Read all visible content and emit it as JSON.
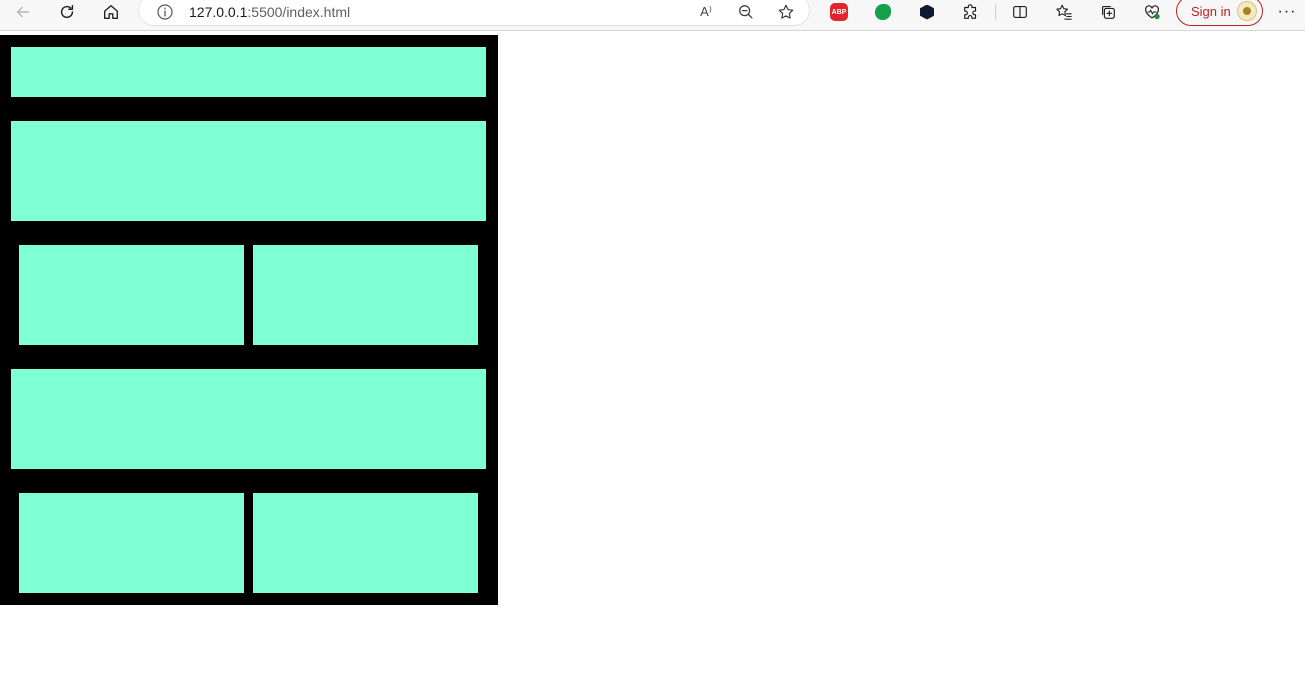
{
  "browser": {
    "url_host": "127.0.0.1",
    "url_rest": ":5500/index.html",
    "read_aloud_label": "A⁾",
    "abp_label": "ABP",
    "signin_label": "Sign in",
    "more_label": "···",
    "icons": [
      "back-icon",
      "refresh-icon",
      "home-icon",
      "info-icon",
      "read-aloud-icon",
      "zoom-out-icon",
      "favorite-star-icon",
      "adblock-plus-icon",
      "evernote-icon",
      "hex-extension-icon",
      "extensions-puzzle-icon",
      "split-screen-icon",
      "favorites-icon",
      "collections-icon",
      "browser-essentials-icon",
      "profile-avatar-icon",
      "more-icon"
    ]
  },
  "page": {
    "background": "#000000",
    "box_color": "#7fffd4"
  }
}
